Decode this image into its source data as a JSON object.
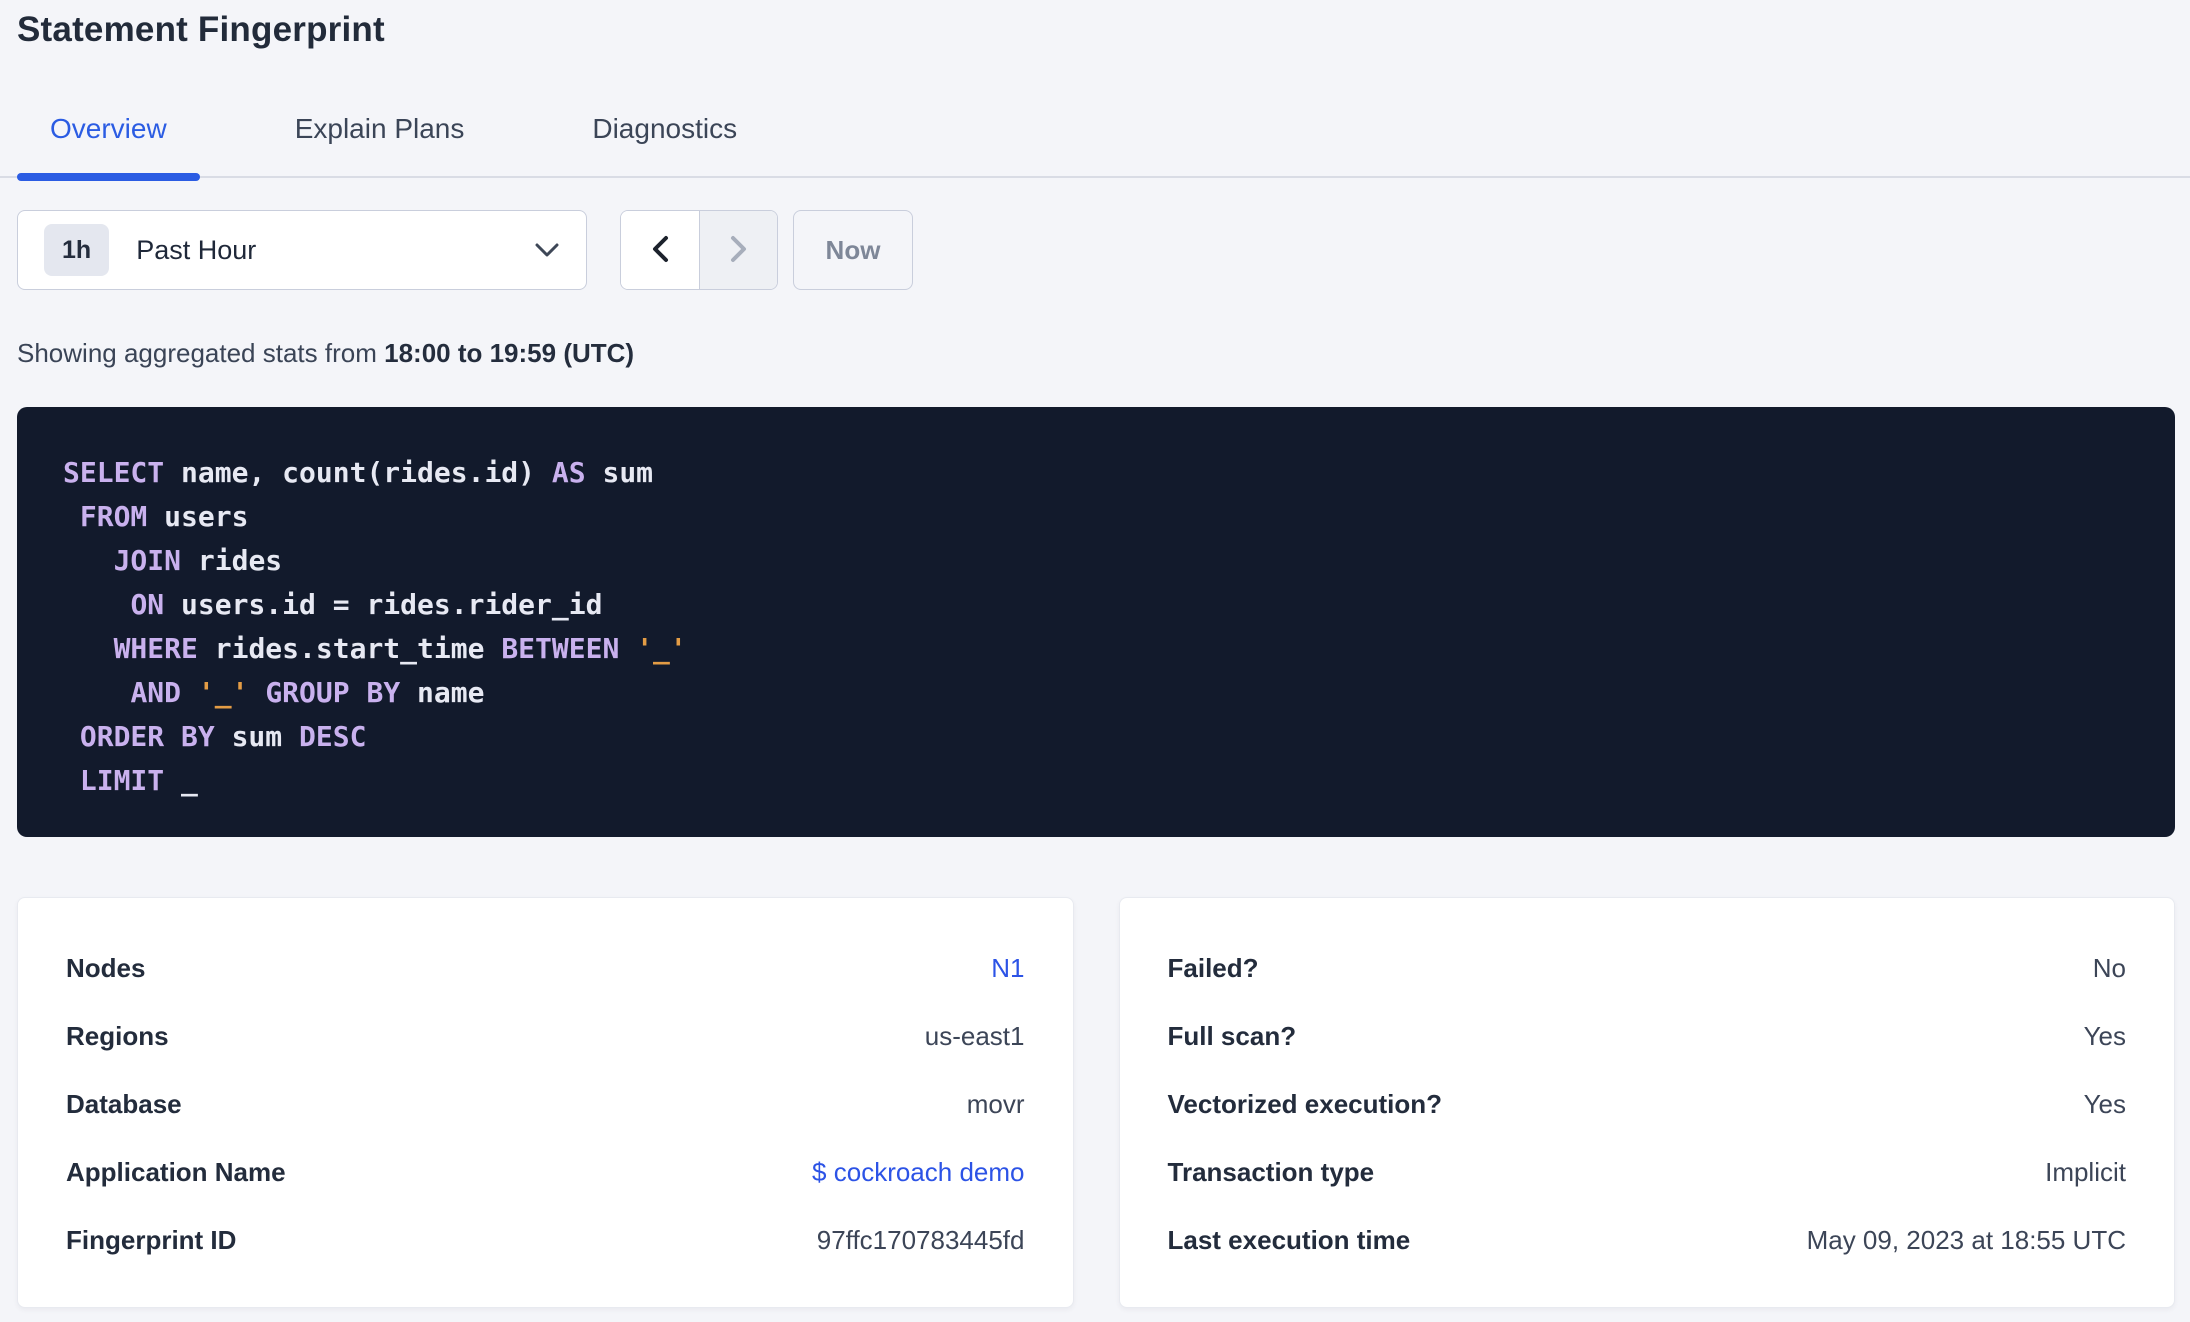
{
  "page": {
    "title": "Statement Fingerprint"
  },
  "colors": {
    "accent_blue": "#2b5ce3",
    "link_blue": "#2c53e6",
    "sql_background": "#121a2c",
    "sql_keyword": "#c9b1ee",
    "sql_identifier": "#e7e9f3",
    "sql_literal": "#e39c45"
  },
  "tabs": [
    {
      "label": "Overview",
      "active": true
    },
    {
      "label": "Explain Plans",
      "active": false
    },
    {
      "label": "Diagnostics",
      "active": false
    }
  ],
  "time_picker": {
    "badge": "1h",
    "label": "Past Hour"
  },
  "nav": {
    "now_label": "Now"
  },
  "stats_line": {
    "prefix": "Showing aggregated stats from ",
    "range": "18:00 to 19:59 (UTC)"
  },
  "sql": {
    "lines": [
      [
        {
          "t": "k",
          "v": "SELECT"
        },
        {
          "t": "i",
          "v": " name, count(rides.id) "
        },
        {
          "t": "k",
          "v": "AS"
        },
        {
          "t": "i",
          "v": " sum"
        }
      ],
      [
        {
          "t": "i",
          "v": " "
        },
        {
          "t": "k",
          "v": "FROM"
        },
        {
          "t": "i",
          "v": " users"
        }
      ],
      [
        {
          "t": "i",
          "v": "   "
        },
        {
          "t": "k",
          "v": "JOIN"
        },
        {
          "t": "i",
          "v": " rides"
        }
      ],
      [
        {
          "t": "i",
          "v": "    "
        },
        {
          "t": "k",
          "v": "ON"
        },
        {
          "t": "i",
          "v": " users.id = rides.rider_id"
        }
      ],
      [
        {
          "t": "i",
          "v": "   "
        },
        {
          "t": "k",
          "v": "WHERE"
        },
        {
          "t": "i",
          "v": " rides.start_time "
        },
        {
          "t": "k",
          "v": "BETWEEN"
        },
        {
          "t": "i",
          "v": " "
        },
        {
          "t": "l",
          "v": "'_'"
        }
      ],
      [
        {
          "t": "i",
          "v": "    "
        },
        {
          "t": "k",
          "v": "AND"
        },
        {
          "t": "i",
          "v": " "
        },
        {
          "t": "l",
          "v": "'_'"
        },
        {
          "t": "i",
          "v": " "
        },
        {
          "t": "k",
          "v": "GROUP BY"
        },
        {
          "t": "i",
          "v": " name"
        }
      ],
      [
        {
          "t": "i",
          "v": " "
        },
        {
          "t": "k",
          "v": "ORDER BY"
        },
        {
          "t": "i",
          "v": " sum "
        },
        {
          "t": "k",
          "v": "DESC"
        }
      ],
      [
        {
          "t": "i",
          "v": " "
        },
        {
          "t": "k",
          "v": "LIMIT"
        },
        {
          "t": "i",
          "v": " _"
        }
      ]
    ]
  },
  "cards": [
    {
      "rows": [
        {
          "label": "Nodes",
          "value": "N1",
          "link": true
        },
        {
          "label": "Regions",
          "value": "us-east1",
          "link": false
        },
        {
          "label": "Database",
          "value": "movr",
          "link": false
        },
        {
          "label": "Application Name",
          "value": "$ cockroach demo",
          "link": true
        },
        {
          "label": "Fingerprint ID",
          "value": "97ffc170783445fd",
          "link": false
        }
      ]
    },
    {
      "rows": [
        {
          "label": "Failed?",
          "value": "No",
          "link": false
        },
        {
          "label": "Full scan?",
          "value": "Yes",
          "link": false
        },
        {
          "label": "Vectorized execution?",
          "value": "Yes",
          "link": false
        },
        {
          "label": "Transaction type",
          "value": "Implicit",
          "link": false
        },
        {
          "label": "Last execution time",
          "value": "May 09, 2023 at 18:55 UTC",
          "link": false
        }
      ]
    }
  ]
}
